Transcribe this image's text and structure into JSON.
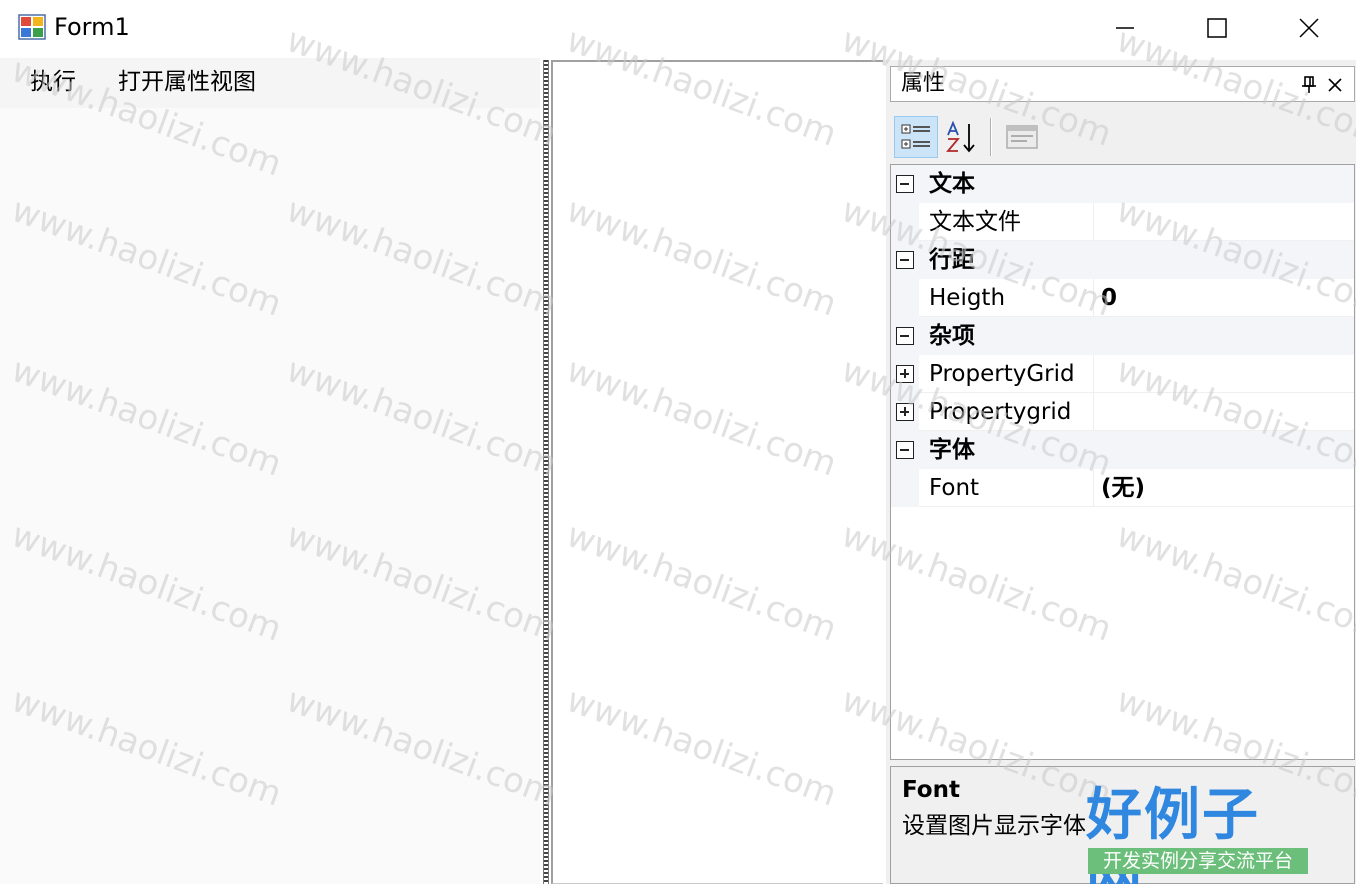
{
  "window": {
    "title": "Form1"
  },
  "menu": {
    "items": [
      {
        "label": "执行"
      },
      {
        "label": "打开属性视图"
      }
    ]
  },
  "properties_panel": {
    "title": "属性",
    "toolbar": {
      "buttons": [
        "categorized-icon",
        "alphabetical-icon",
        "property-pages-icon"
      ]
    },
    "categories": [
      {
        "name": "文本",
        "expanded": true,
        "properties": [
          {
            "name": "文本文件",
            "value": ""
          }
        ]
      },
      {
        "name": "行距",
        "expanded": true,
        "properties": [
          {
            "name": "Heigth",
            "value": "0"
          }
        ]
      },
      {
        "name": "杂项",
        "expanded": true,
        "properties": [
          {
            "name": "PropertyGrid",
            "value": "",
            "expandable": true
          },
          {
            "name": "Propertygrid",
            "value": "",
            "expandable": true
          }
        ]
      },
      {
        "name": "字体",
        "expanded": true,
        "properties": [
          {
            "name": "Font",
            "value": "(无)"
          }
        ]
      }
    ],
    "help": {
      "title": "Font",
      "description": "设置图片显示字体"
    }
  },
  "watermark": {
    "text": "www.haolizi.com",
    "brand": "好例子网",
    "brand_tagline": "开发实例分享交流平台"
  }
}
